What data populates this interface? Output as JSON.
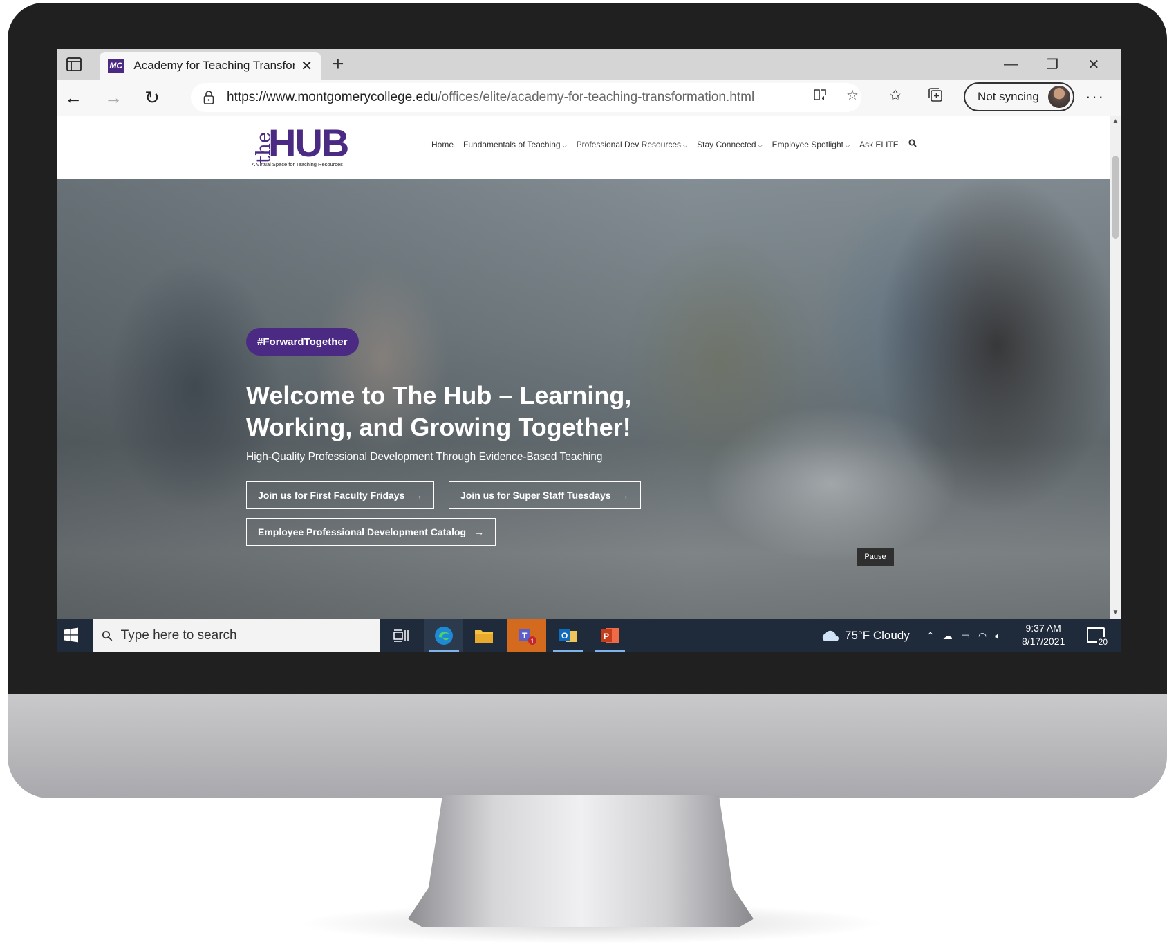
{
  "browser": {
    "tab_title": "Academy for Teaching Transform",
    "url_domain": "https://www.montgomerycollege.edu",
    "url_path": "/offices/elite/academy-for-teaching-transformation.html",
    "sync_label": "Not syncing",
    "favicon_text": "MC"
  },
  "site": {
    "logo_the": "the",
    "logo_hub": "HUB",
    "logo_tagline": "A Virtual Space for Teaching Resources",
    "nav": [
      {
        "label": "Home"
      },
      {
        "label": "Fundamentals of Teaching"
      },
      {
        "label": "Professional Dev Resources"
      },
      {
        "label": "Stay Connected"
      },
      {
        "label": "Employee Spotlight"
      },
      {
        "label": "Ask ELITE"
      }
    ]
  },
  "hero": {
    "hashtag": "#ForwardTogether",
    "title": "Welcome to The Hub – Learning, Working, and Growing Together!",
    "subtitle": "High-Quality Professional Development Through Evidence-Based Teaching",
    "cta_1": "Join us for First Faculty Fridays",
    "cta_2": "Join us for Super Staff Tuesdays",
    "cta_3": "Employee Professional Development Catalog",
    "pause_label": "Pause"
  },
  "taskbar": {
    "search_placeholder": "Type here to search",
    "weather": "75°F  Cloudy",
    "time": "9:37 AM",
    "date": "8/17/2021",
    "notification_count": "20",
    "teams_badge": "1"
  },
  "colors": {
    "brand_purple": "#4b2a83",
    "taskbar": "#1f2a3a"
  }
}
